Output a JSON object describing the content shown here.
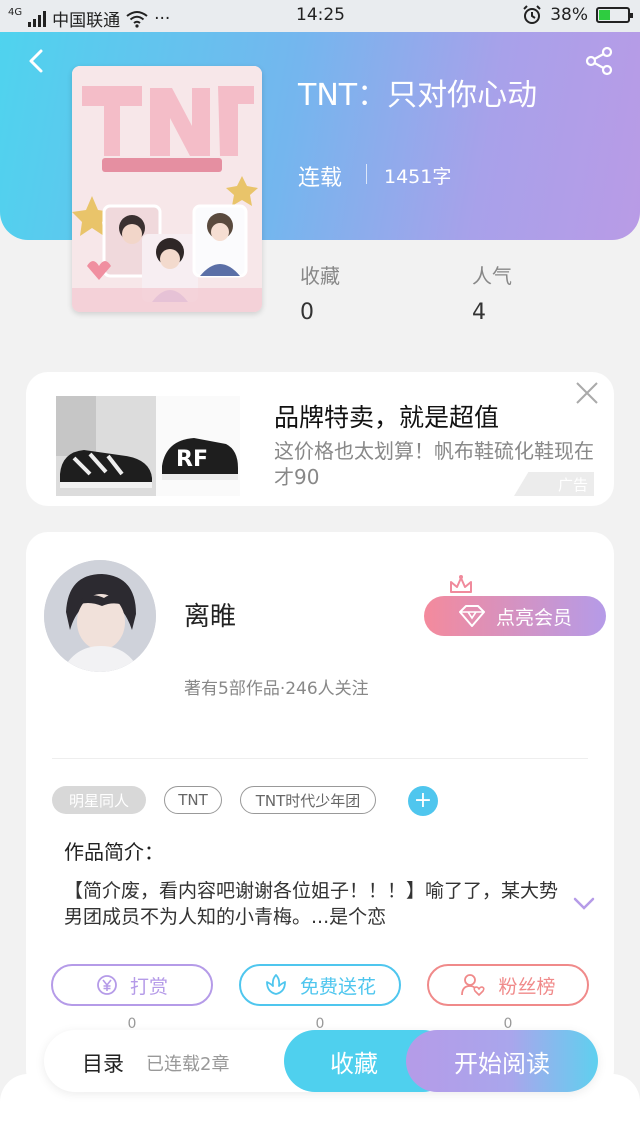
{
  "status_bar": {
    "network": "4G",
    "carrier": "中国联通",
    "more": "···",
    "time": "14:25",
    "battery": "38%",
    "battery_level": 0.38
  },
  "book": {
    "title": "TNT：只对你心动",
    "status": "连载",
    "word_count": "1451字",
    "cover_icon": "book-cover-image"
  },
  "stats": [
    {
      "label": "收藏",
      "value": "0"
    },
    {
      "label": "人气",
      "value": "4"
    }
  ],
  "ad": {
    "title": "品牌特卖，就是超值",
    "description": "这价格也太划算！帆布鞋硫化鞋现在才90",
    "tag": "广告"
  },
  "author": {
    "name": "离睢",
    "meta": "著有5部作品·246人关注",
    "vip_button": "点亮会员"
  },
  "tags": [
    "明星同人",
    "TNT",
    "TNT时代少年团"
  ],
  "intro": {
    "label": "作品简介：",
    "text": "【简介废，看内容吧谢谢各位姐子！！！】喻了了，某大势男团成员不为人知的小青梅。...是个恋"
  },
  "actions": [
    {
      "label": "打赏",
      "count": "0",
      "color": "#b59be8"
    },
    {
      "label": "免费送花",
      "count": "0",
      "color": "#4fc6ee"
    },
    {
      "label": "粉丝榜",
      "count": "0",
      "color": "#f08a8a"
    }
  ],
  "bottom_bar": {
    "toc": "目录",
    "chapters": "已连载2章",
    "collect": "收藏",
    "read": "开始阅读"
  },
  "colors": {
    "header_gradient_start": "#4fd3ee",
    "header_gradient_end": "#b99be6",
    "accent_blue": "#4fc6ee",
    "accent_purple": "#b59be8",
    "accent_pink": "#f48a9c"
  }
}
